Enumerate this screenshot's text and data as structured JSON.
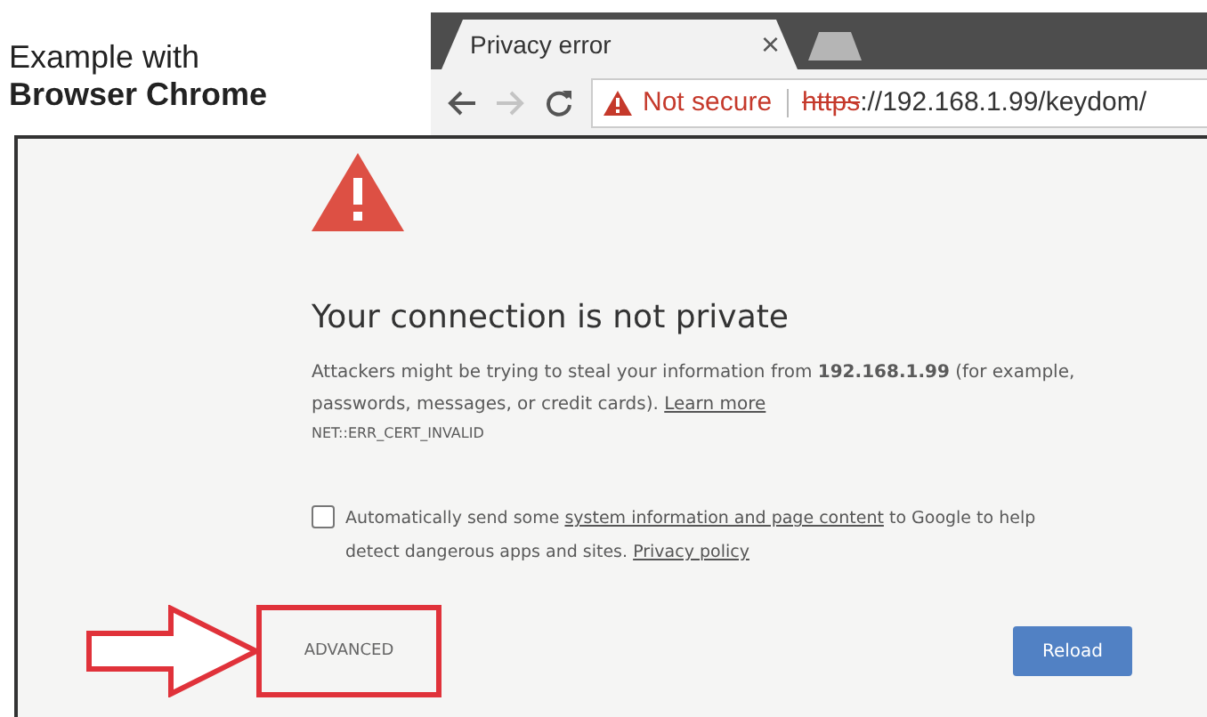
{
  "caption": {
    "line_1": "Example with",
    "line_2": "Browser Chrome"
  },
  "browser": {
    "tab": {
      "title": "Privacy error",
      "close": "×"
    },
    "address_bar": {
      "security": "Not secure",
      "scheme": "https",
      "url_rest": "://192.168.1.99/keydom/"
    }
  },
  "page": {
    "heading": "Your connection is not private",
    "message": "Attackers might be trying to steal your information from **192.168.1.99** (for example, passwords, messages, or credit cards).",
    "learn_more": "Learn more",
    "error_code": "NET::ERR_CERT_INVALID",
    "report": {
      "checked": false,
      "text_before": "Automatically send some",
      "link": "system information and page content",
      "text_middle": "to Google to help detect dangerous apps and sites.",
      "privacy_link": "Privacy policy"
    },
    "advanced": "ADVANCED",
    "reload": "Reload"
  }
}
